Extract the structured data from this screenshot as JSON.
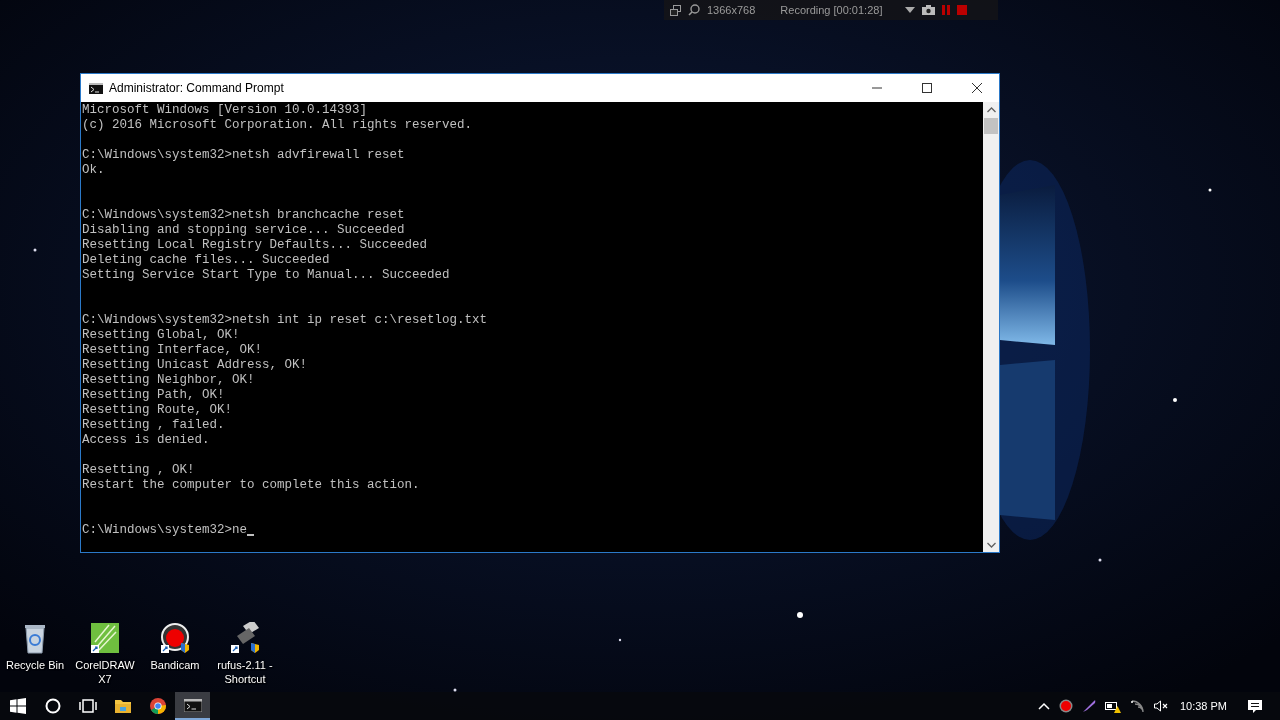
{
  "recorder_bar": {
    "resolution": "1366x768",
    "status": "Recording [00:01:28]"
  },
  "window": {
    "title": "Administrator: Command Prompt"
  },
  "console": {
    "lines": [
      {
        "kind": "text",
        "text": "Microsoft Windows [Version 10.0.14393]"
      },
      {
        "kind": "text",
        "text": "(c) 2016 Microsoft Corporation. All rights reserved."
      },
      {
        "kind": "blank"
      },
      {
        "kind": "text",
        "text": "C:\\Windows\\system32>netsh advfirewall reset"
      },
      {
        "kind": "text",
        "text": "Ok."
      },
      {
        "kind": "blank"
      },
      {
        "kind": "blank"
      },
      {
        "kind": "text",
        "text": "C:\\Windows\\system32>netsh branchcache reset"
      },
      {
        "kind": "text",
        "text": "Disabling and stopping service... Succeeded"
      },
      {
        "kind": "text",
        "text": "Resetting Local Registry Defaults... Succeeded"
      },
      {
        "kind": "text",
        "text": "Deleting cache files... Succeeded"
      },
      {
        "kind": "text",
        "text": "Setting Service Start Type to Manual... Succeeded"
      },
      {
        "kind": "blank"
      },
      {
        "kind": "blank"
      },
      {
        "kind": "text",
        "text": "C:\\Windows\\system32>netsh int ip reset c:\\resetlog.txt"
      },
      {
        "kind": "text",
        "text": "Resetting Global, OK!"
      },
      {
        "kind": "text",
        "text": "Resetting Interface, OK!"
      },
      {
        "kind": "text",
        "text": "Resetting Unicast Address, OK!"
      },
      {
        "kind": "text",
        "text": "Resetting Neighbor, OK!"
      },
      {
        "kind": "text",
        "text": "Resetting Path, OK!"
      },
      {
        "kind": "text",
        "text": "Resetting Route, OK!"
      },
      {
        "kind": "text",
        "text": "Resetting , failed."
      },
      {
        "kind": "text",
        "text": "Access is denied."
      },
      {
        "kind": "blank"
      },
      {
        "kind": "text",
        "text": "Resetting , OK!"
      },
      {
        "kind": "text",
        "text": "Restart the computer to complete this action."
      },
      {
        "kind": "blank"
      },
      {
        "kind": "blank"
      },
      {
        "kind": "text",
        "text": "C:\\Windows\\system32>ne",
        "cursor": true
      }
    ]
  },
  "desktop_icons": [
    {
      "kind": "recycle",
      "label": "Recycle Bin"
    },
    {
      "kind": "corel",
      "label": "CorelDRAW X7"
    },
    {
      "kind": "bandicam",
      "label": "Bandicam"
    },
    {
      "kind": "usb",
      "label": "rufus-2.11 - Shortcut"
    }
  ],
  "taskbar": {
    "apps": [
      {
        "kind": "start",
        "selected": false
      },
      {
        "kind": "search",
        "selected": false
      },
      {
        "kind": "taskview",
        "selected": false
      },
      {
        "kind": "folder",
        "selected": false
      },
      {
        "kind": "browser",
        "selected": false
      },
      {
        "kind": "terminal",
        "selected": true
      }
    ],
    "tray": [
      {
        "kind": "chevron"
      },
      {
        "kind": "record"
      },
      {
        "kind": "feather"
      },
      {
        "kind": "battery"
      },
      {
        "kind": "wifi"
      },
      {
        "kind": "mute"
      }
    ],
    "clock": "10:38 PM"
  }
}
